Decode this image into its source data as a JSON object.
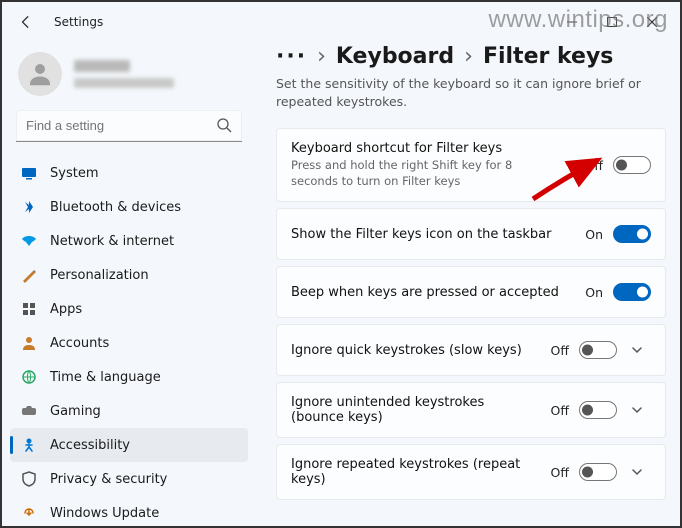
{
  "window": {
    "title": "Settings"
  },
  "watermark": "www.wintips.org",
  "search": {
    "placeholder": "Find a setting"
  },
  "sidebar": {
    "items": [
      {
        "label": "System"
      },
      {
        "label": "Bluetooth & devices"
      },
      {
        "label": "Network & internet"
      },
      {
        "label": "Personalization"
      },
      {
        "label": "Apps"
      },
      {
        "label": "Accounts"
      },
      {
        "label": "Time & language"
      },
      {
        "label": "Gaming"
      },
      {
        "label": "Accessibility"
      },
      {
        "label": "Privacy & security"
      },
      {
        "label": "Windows Update"
      }
    ]
  },
  "breadcrumb": {
    "dots": "···",
    "sep": "›",
    "parent": "Keyboard",
    "current": "Filter keys"
  },
  "page": {
    "description": "Set the sensitivity of the keyboard so it can ignore brief or repeated keystrokes."
  },
  "settings": [
    {
      "title": "Keyboard shortcut for Filter keys",
      "sub": "Press and hold the right Shift key for 8 seconds to turn on Filter keys",
      "state": "Off",
      "on": false,
      "expand": false
    },
    {
      "title": "Show the Filter keys icon on the taskbar",
      "sub": "",
      "state": "On",
      "on": true,
      "expand": false
    },
    {
      "title": "Beep when keys are pressed or accepted",
      "sub": "",
      "state": "On",
      "on": true,
      "expand": false
    },
    {
      "title": "Ignore quick keystrokes (slow keys)",
      "sub": "",
      "state": "Off",
      "on": false,
      "expand": true
    },
    {
      "title": "Ignore unintended keystrokes (bounce keys)",
      "sub": "",
      "state": "Off",
      "on": false,
      "expand": true
    },
    {
      "title": "Ignore repeated keystrokes (repeat keys)",
      "sub": "",
      "state": "Off",
      "on": false,
      "expand": true
    }
  ]
}
